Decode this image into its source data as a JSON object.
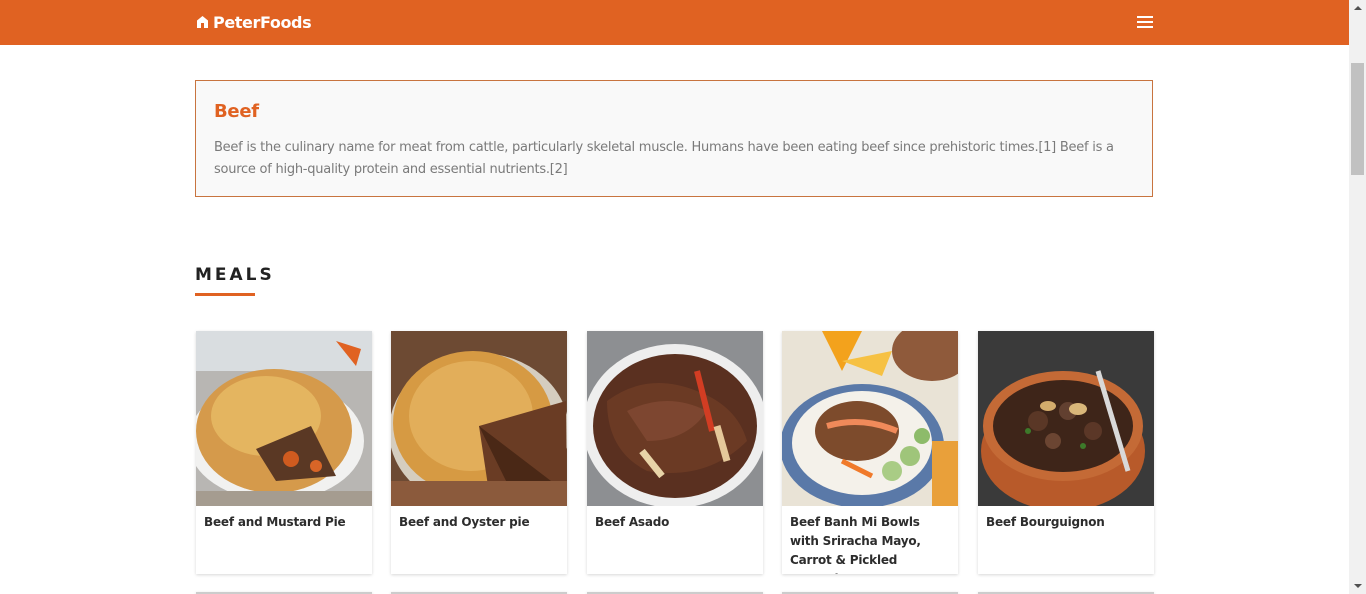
{
  "navbar": {
    "brand": "PeterFoods",
    "brand_icon": "home-icon",
    "menu_icon": "hamburger-menu-icon",
    "color": "#e06222"
  },
  "category": {
    "title": "Beef",
    "description": "Beef is the culinary name for meat from cattle, particularly skeletal muscle. Humans have been eating beef since prehistoric times.[1] Beef is a source of high-quality protein and essential nutrients.[2]"
  },
  "meals": {
    "heading": "MEALS",
    "items": [
      {
        "name": "Beef and Mustard Pie"
      },
      {
        "name": "Beef and Oyster pie"
      },
      {
        "name": "Beef Asado"
      },
      {
        "name": "Beef Banh Mi Bowls with Sriracha Mayo, Carrot & Pickled Cucumber"
      },
      {
        "name": "Beef Bourguignon"
      }
    ]
  }
}
